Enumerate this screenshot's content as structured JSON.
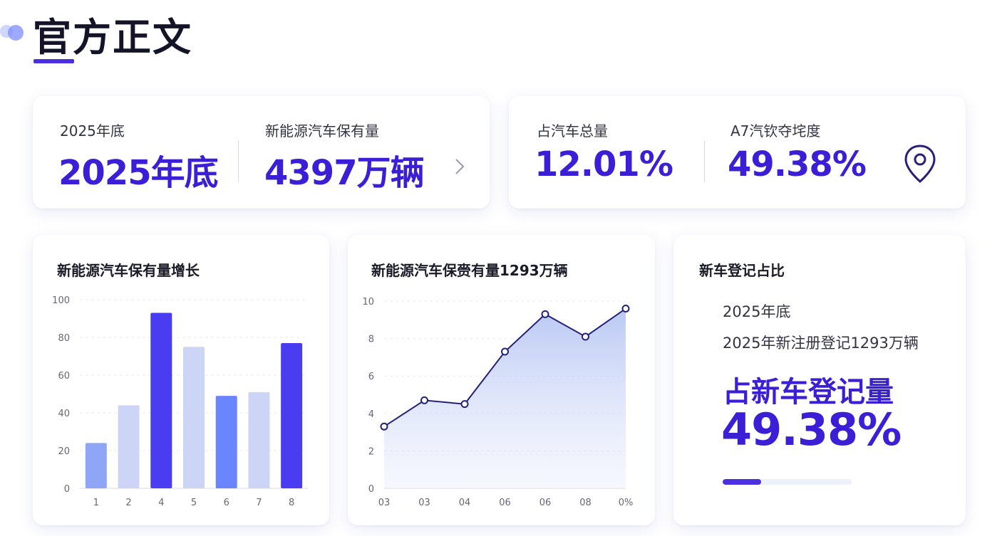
{
  "header": {
    "title": "官方正文"
  },
  "stats_left": {
    "period_label": "2025年底",
    "period_value": "2025年底",
    "ev_label": "新能源汽车保有量",
    "ev_value": "4397万辆"
  },
  "stats_right": {
    "share_label": "占汽车总量",
    "share_value": "12.01%",
    "other_label": "A7汽钦夺垞度",
    "other_value": "49.38%",
    "icon": "location-pin-icon"
  },
  "bar_card": {
    "title": "新能源汽车保有量增长"
  },
  "line_card": {
    "title": "新能源汽车保赍有量1293万辆"
  },
  "reg_card": {
    "title": "新车登记占比",
    "line1": "2025年底",
    "line2": "2025年新注册登记1293万辆",
    "headline": "占新车登记量",
    "percent": "49.38%",
    "progress": 0.3
  },
  "colors": {
    "accent": "#3a1fd6",
    "bar_dark": "#4a3cf0",
    "bar_mid": "#6b84ff",
    "bar_light": "#cdd5f7",
    "bar_lightmid": "#8ea6f5",
    "line": "#24217a"
  },
  "chart_data": [
    {
      "type": "bar",
      "categories": [
        "1",
        "2",
        "4",
        "5",
        "6",
        "7",
        "8"
      ],
      "values": [
        24,
        44,
        93,
        75,
        49,
        51,
        77
      ],
      "bar_colors": [
        "#8ea6f5",
        "#cdd5f7",
        "#4a3cf0",
        "#cdd5f7",
        "#6b84ff",
        "#cdd5f7",
        "#4a3cf0"
      ],
      "ylim": [
        0,
        100
      ],
      "yticks": [
        "0",
        "20",
        "40",
        "60",
        "80",
        "100"
      ],
      "grid": true
    },
    {
      "type": "area",
      "x": [
        "03",
        "03",
        "04",
        "06",
        "06",
        "08",
        "0%"
      ],
      "y": [
        3.3,
        4.7,
        4.5,
        7.3,
        9.3,
        8.1,
        9.6
      ],
      "ylim": [
        0,
        10
      ],
      "yticks": [
        "0",
        "2",
        "4",
        "6",
        "8",
        "10"
      ],
      "grid": true
    }
  ]
}
